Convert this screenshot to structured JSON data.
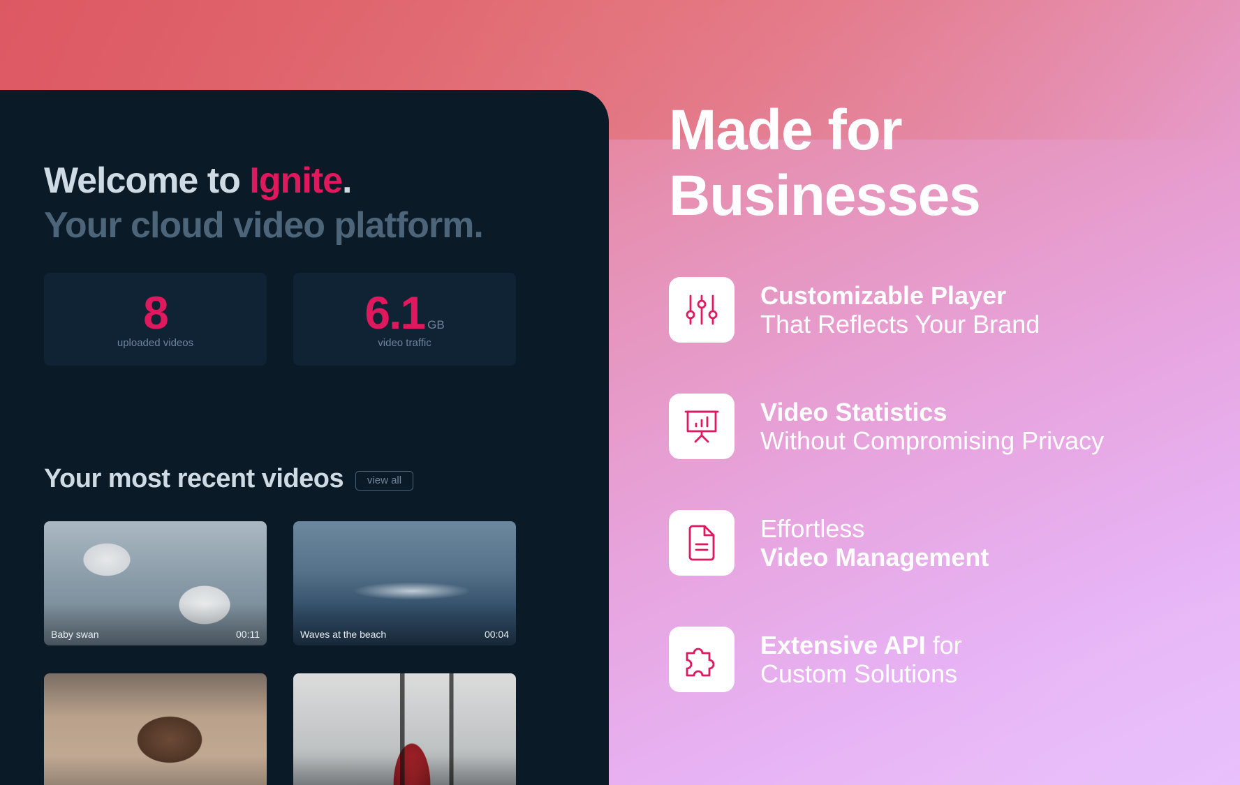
{
  "dashboard": {
    "welcome_prefix": "Welcome to ",
    "brand": "Ignite",
    "welcome_suffix": ".",
    "subtitle": "Your cloud video platform.",
    "stats": [
      {
        "value": "8",
        "unit": "",
        "caption": "uploaded videos"
      },
      {
        "value": "6.1",
        "unit": "GB",
        "caption": "video traffic"
      }
    ],
    "recent_title": "Your most recent videos",
    "view_all_label": "view all",
    "videos": [
      {
        "title": "Baby swan",
        "duration": "00:11"
      },
      {
        "title": "Waves at the beach",
        "duration": "00:04"
      },
      {
        "title": "",
        "duration": ""
      },
      {
        "title": "",
        "duration": ""
      }
    ]
  },
  "marketing": {
    "headline_line1": "Made for",
    "headline_line2": "Businesses",
    "features": [
      {
        "icon": "sliders-icon",
        "bold": "Customizable Player",
        "normal": "That Reflects Your Brand"
      },
      {
        "icon": "presentation-chart-icon",
        "bold": "Video Statistics",
        "normal": "Without Compromising Privacy"
      },
      {
        "icon": "document-icon",
        "normal": "Effortless",
        "bold": "Video Management"
      },
      {
        "icon": "puzzle-icon",
        "bold": "Extensive API",
        "normal_inline": " for",
        "normal": "Custom Solutions"
      }
    ]
  },
  "colors": {
    "brand": "#e0195f",
    "panel_bg": "#0b1a27",
    "card_bg": "#0f2334"
  }
}
